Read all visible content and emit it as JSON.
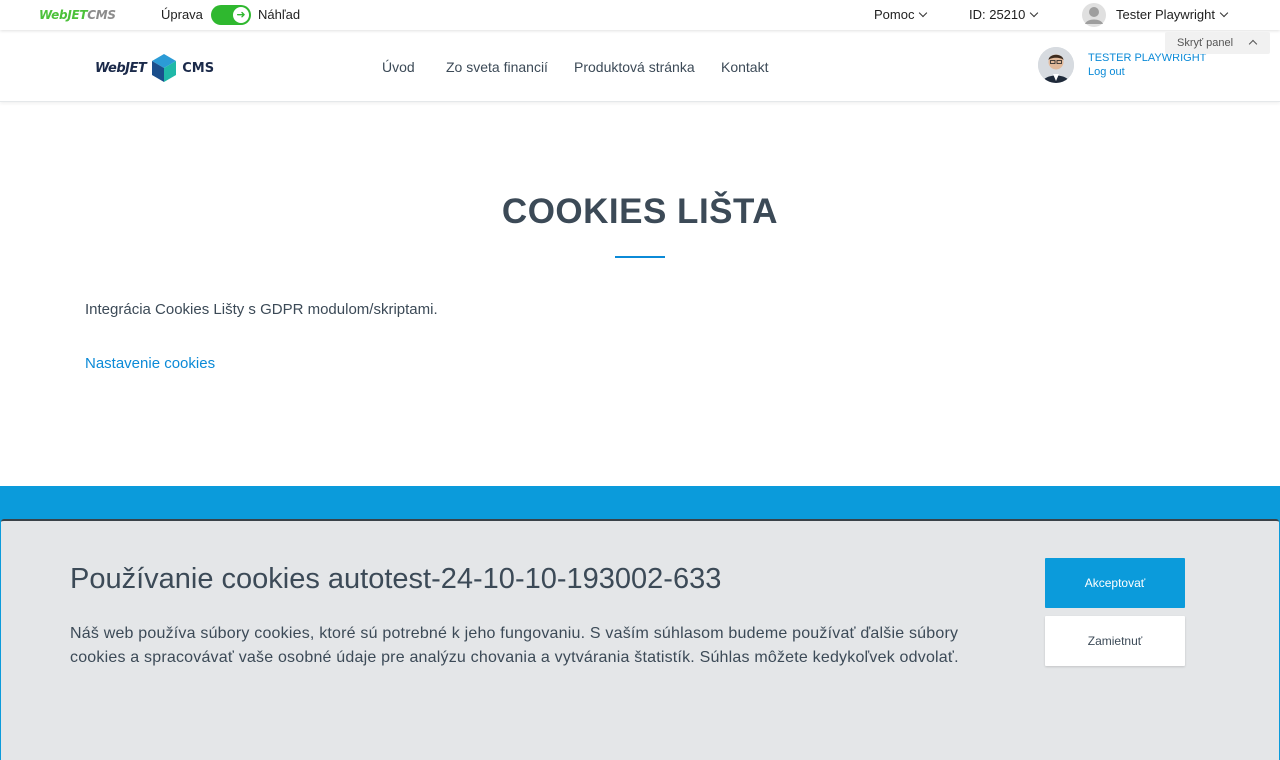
{
  "admin_bar": {
    "logo_part1": "Web",
    "logo_part2": "JET",
    "logo_part3": "CMS",
    "mode_edit_label": "Úprava",
    "mode_preview_label": "Náhľad",
    "help_label": "Pomoc",
    "doc_id_label": "ID: 25210",
    "user_name": "Tester Playwright",
    "hide_panel_label": "Skryť panel"
  },
  "header": {
    "logo_left": "WebJET",
    "logo_right": "CMS",
    "nav": [
      {
        "label": "Úvod"
      },
      {
        "label": "Zo sveta financií"
      },
      {
        "label": "Produktová stránka"
      },
      {
        "label": "Kontakt"
      }
    ],
    "user_name": "TESTER PLAYWRIGHT",
    "logout_label": "Log out"
  },
  "main": {
    "title": "COOKIES LIŠTA",
    "intro": "Integrácia Cookies Lišty s GDPR modulom/skriptami.",
    "settings_link": "Nastavenie cookies"
  },
  "cookie_bar": {
    "title": "Používanie cookies autotest-24-10-10-193002-633",
    "text": "Náš web používa súbory cookies, ktoré sú potrebné k jeho fungovaniu. S vaším súhlasom budeme používať ďalšie súbory cookies a spracovávať vaše osobné údaje pre analýzu chovania a vytvárania štatistík. Súhlas môžete kedykoľvek odvolať.",
    "accept_label": "Akceptovať",
    "reject_label": "Zamietnuť"
  },
  "colors": {
    "accent_blue": "#0b9bdb",
    "toggle_green": "#2fb82f",
    "text_dark": "#3c4a57"
  }
}
